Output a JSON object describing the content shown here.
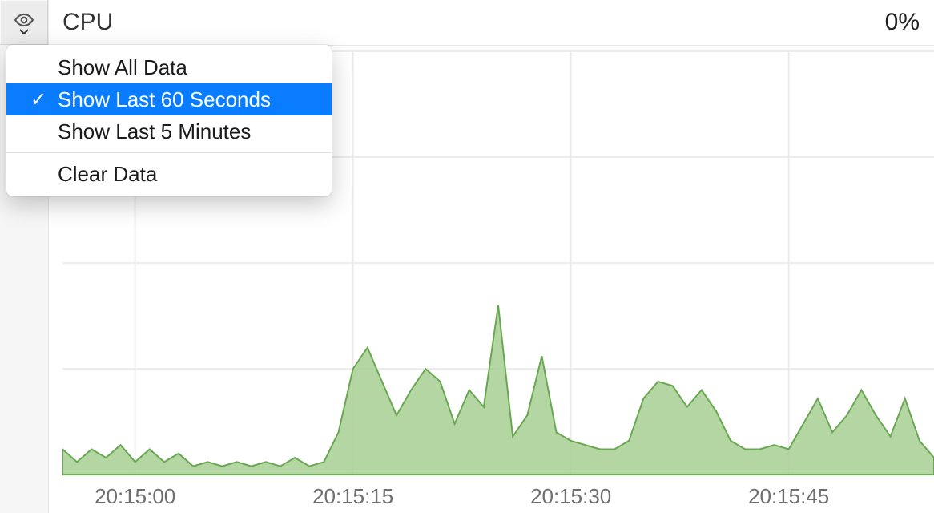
{
  "header": {
    "title": "CPU",
    "value": "0%"
  },
  "menu": {
    "items": [
      {
        "label": "Show All Data",
        "selected": false
      },
      {
        "label": "Show Last 60 Seconds",
        "selected": true
      },
      {
        "label": "Show Last 5 Minutes",
        "selected": false
      }
    ],
    "clear_label": "Clear Data"
  },
  "chart_data": {
    "type": "area",
    "title": "CPU",
    "xlabel": "",
    "ylabel": "",
    "ylim": [
      0,
      100
    ],
    "x_ticks": [
      "20:15:00",
      "20:15:15",
      "20:15:30",
      "20:15:45"
    ],
    "x": [
      -5,
      -4,
      -3,
      -2,
      -1,
      0,
      1,
      2,
      3,
      4,
      5,
      6,
      7,
      8,
      9,
      10,
      11,
      12,
      13,
      14,
      15,
      16,
      17,
      18,
      19,
      20,
      21,
      22,
      23,
      24,
      25,
      26,
      27,
      28,
      29,
      30,
      31,
      32,
      33,
      34,
      35,
      36,
      37,
      38,
      39,
      40,
      41,
      42,
      43,
      44,
      45,
      46,
      47,
      48,
      49,
      50,
      51,
      52,
      53,
      54,
      55
    ],
    "values": [
      6,
      3,
      6,
      4,
      7,
      3,
      6,
      3,
      5,
      2,
      3,
      2,
      3,
      2,
      3,
      2,
      4,
      2,
      3,
      10,
      25,
      30,
      22,
      14,
      20,
      25,
      22,
      12,
      20,
      16,
      40,
      9,
      14,
      28,
      10,
      8,
      7,
      6,
      6,
      8,
      18,
      22,
      21,
      16,
      20,
      15,
      8,
      6,
      6,
      7,
      6,
      12,
      18,
      10,
      14,
      20,
      14,
      9,
      18,
      8,
      4
    ]
  }
}
